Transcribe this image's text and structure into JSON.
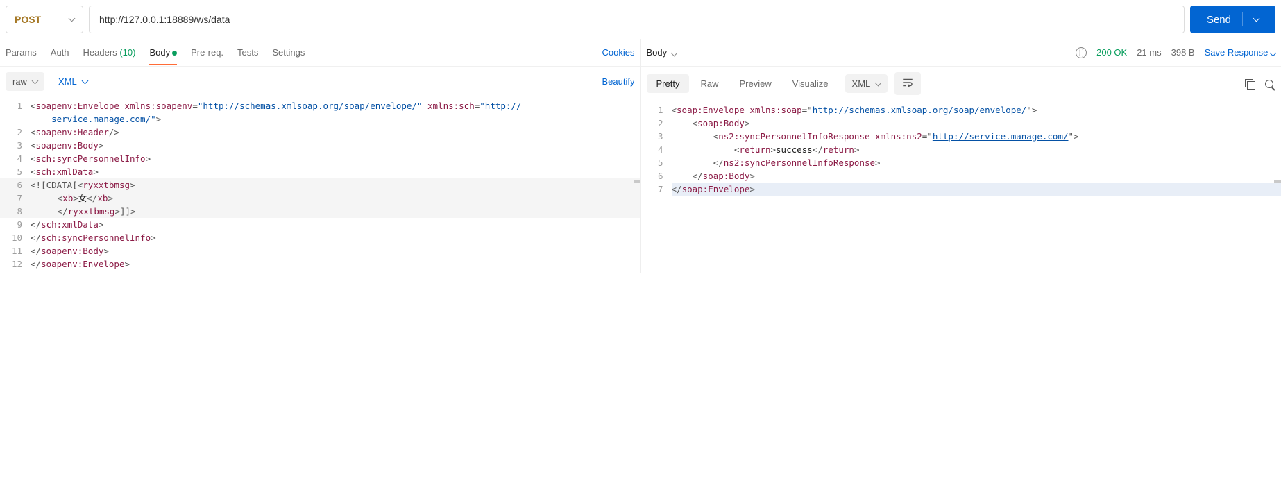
{
  "request": {
    "method": "POST",
    "url": "http://127.0.0.1:18889/ws/data",
    "send": "Send",
    "tabs": {
      "params": "Params",
      "auth": "Auth",
      "headers": "Headers",
      "headers_count": "(10)",
      "body": "Body",
      "prereq": "Pre-req.",
      "tests": "Tests",
      "settings": "Settings"
    },
    "cookies": "Cookies",
    "body_type": "raw",
    "body_lang": "XML",
    "beautify": "Beautify",
    "lines": [
      {
        "n": "1",
        "html": "<span class='pn'>&lt;</span><span class='tg'>soapenv:Envelope</span> <span class='at'>xmlns:soapenv</span><span class='pn'>=</span><span class='st'>\"http://schemas.xmlsoap.org/soap/envelope/\"</span> <span class='at'>xmlns:sch</span><span class='pn'>=</span><span class='st'>\"http://</span>"
      },
      {
        "n": "",
        "html": "    <span class='st'>service.manage.com/\"</span><span class='pn'>&gt;</span>"
      },
      {
        "n": "2",
        "html": "<span class='pn'>&lt;</span><span class='tg'>soapenv:Header</span><span class='pn'>/&gt;</span>"
      },
      {
        "n": "3",
        "html": "<span class='pn'>&lt;</span><span class='tg'>soapenv:Body</span><span class='pn'>&gt;</span>"
      },
      {
        "n": "4",
        "html": "<span class='pn'>&lt;</span><span class='tg'>sch:syncPersonnelInfo</span><span class='pn'>&gt;</span>"
      },
      {
        "n": "5",
        "html": "<span class='pn'>&lt;</span><span class='tg'>sch:xmlData</span><span class='pn'>&gt;</span>"
      },
      {
        "n": "6",
        "html": "<span class='cd'>&lt;![CDATA[</span><span class='pn'>&lt;</span><span class='tg'>ryxxtbmsg</span><span class='pn'>&gt;</span>",
        "hl": true
      },
      {
        "n": "7",
        "html": "<span class='indent-guide' style='margin-left:0'></span>     <span class='pn'>&lt;</span><span class='tg'>xb</span><span class='pn'>&gt;</span><span class='tx'>女</span><span class='pn'>&lt;/</span><span class='tg'>xb</span><span class='pn'>&gt;</span>",
        "hl": true
      },
      {
        "n": "8",
        "html": "<span class='indent-guide' style='margin-left:0'></span>     <span class='pn'>&lt;/</span><span class='tg'>ryxxtbmsg</span><span class='pn'>&gt;</span><span class='cd'>]]&gt;</span>",
        "hl": true
      },
      {
        "n": "9",
        "html": "<span class='pn'>&lt;/</span><span class='tg'>sch:xmlData</span><span class='pn'>&gt;</span>"
      },
      {
        "n": "10",
        "html": "<span class='pn'>&lt;/</span><span class='tg'>sch:syncPersonnelInfo</span><span class='pn'>&gt;</span>"
      },
      {
        "n": "11",
        "html": "<span class='pn'>&lt;/</span><span class='tg'>soapenv:Body</span><span class='pn'>&gt;</span>"
      },
      {
        "n": "12",
        "html": "<span class='pn'>&lt;/</span><span class='tg'>soapenv:Envelope</span><span class='pn'>&gt;</span>"
      }
    ]
  },
  "response": {
    "tab": "Body",
    "status_code": "200 OK",
    "time": "21 ms",
    "size": "398 B",
    "save": "Save Response",
    "view_tabs": {
      "pretty": "Pretty",
      "raw": "Raw",
      "preview": "Preview",
      "visualize": "Visualize"
    },
    "lang": "XML",
    "lines": [
      {
        "n": "1",
        "html": "<span class='pn'>&lt;</span><span class='tg'>soap:Envelope</span> <span class='at'>xmlns:soap</span><span class='pn'>=</span><span class='pn'>\"</span><span class='ln'>http://schemas.xmlsoap.org/soap/envelope/</span><span class='pn'>\"</span><span class='pn'>&gt;</span>"
      },
      {
        "n": "2",
        "html": "    <span class='pn'>&lt;</span><span class='tg'>soap:Body</span><span class='pn'>&gt;</span>"
      },
      {
        "n": "3",
        "html": "        <span class='pn'>&lt;</span><span class='tg'>ns2:syncPersonnelInfoResponse</span> <span class='at'>xmlns:ns2</span><span class='pn'>=</span><span class='pn'>\"</span><span class='ln'>http://service.manage.com/</span><span class='pn'>\"</span><span class='pn'>&gt;</span>"
      },
      {
        "n": "4",
        "html": "            <span class='pn'>&lt;</span><span class='tg'>return</span><span class='pn'>&gt;</span><span class='tx'>success</span><span class='pn'>&lt;/</span><span class='tg'>return</span><span class='pn'>&gt;</span>"
      },
      {
        "n": "5",
        "html": "        <span class='pn'>&lt;/</span><span class='tg'>ns2:syncPersonnelInfoResponse</span><span class='pn'>&gt;</span>"
      },
      {
        "n": "6",
        "html": "    <span class='pn'>&lt;/</span><span class='tg'>soap:Body</span><span class='pn'>&gt;</span>"
      },
      {
        "n": "7",
        "html": "<span class='pn'>&lt;/</span><span class='tg'>soap:Envelope</span><span class='pn'>&gt;</span>",
        "sel": true
      }
    ]
  }
}
